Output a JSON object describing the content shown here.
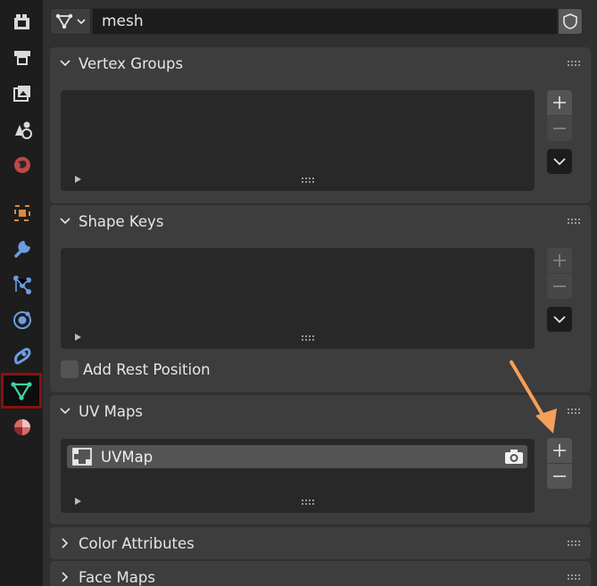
{
  "header": {
    "data_name": "mesh",
    "type_icon": "mesh-data-icon",
    "fake_user_icon": "shield-icon"
  },
  "tabs": [
    {
      "name": "render-icon",
      "active": false
    },
    {
      "name": "output-icon",
      "active": false
    },
    {
      "name": "view-layer-icon",
      "active": false
    },
    {
      "name": "scene-icon",
      "active": false
    },
    {
      "name": "world-icon",
      "active": false
    },
    {
      "name": "object-icon",
      "active": false
    },
    {
      "name": "modifier-wrench-icon",
      "active": false
    },
    {
      "name": "particles-icon",
      "active": false
    },
    {
      "name": "physics-icon",
      "active": false
    },
    {
      "name": "constraints-icon",
      "active": false
    },
    {
      "name": "mesh-data-icon",
      "active": true
    },
    {
      "name": "material-icon",
      "active": false
    }
  ],
  "panels": {
    "vertex_groups": {
      "title": "Vertex Groups",
      "expanded": true
    },
    "shape_keys": {
      "title": "Shape Keys",
      "expanded": true,
      "add_rest_position": "Add Rest Position"
    },
    "uv_maps": {
      "title": "UV Maps",
      "expanded": true,
      "items": [
        "UVMap"
      ]
    },
    "color_attributes": {
      "title": "Color Attributes",
      "expanded": false
    },
    "face_maps": {
      "title": "Face Maps",
      "expanded": false
    }
  },
  "colors": {
    "active_tab_border": "#8b1010",
    "arrow": "#f5a05a",
    "mesh_icon": "#3fd3a6"
  }
}
